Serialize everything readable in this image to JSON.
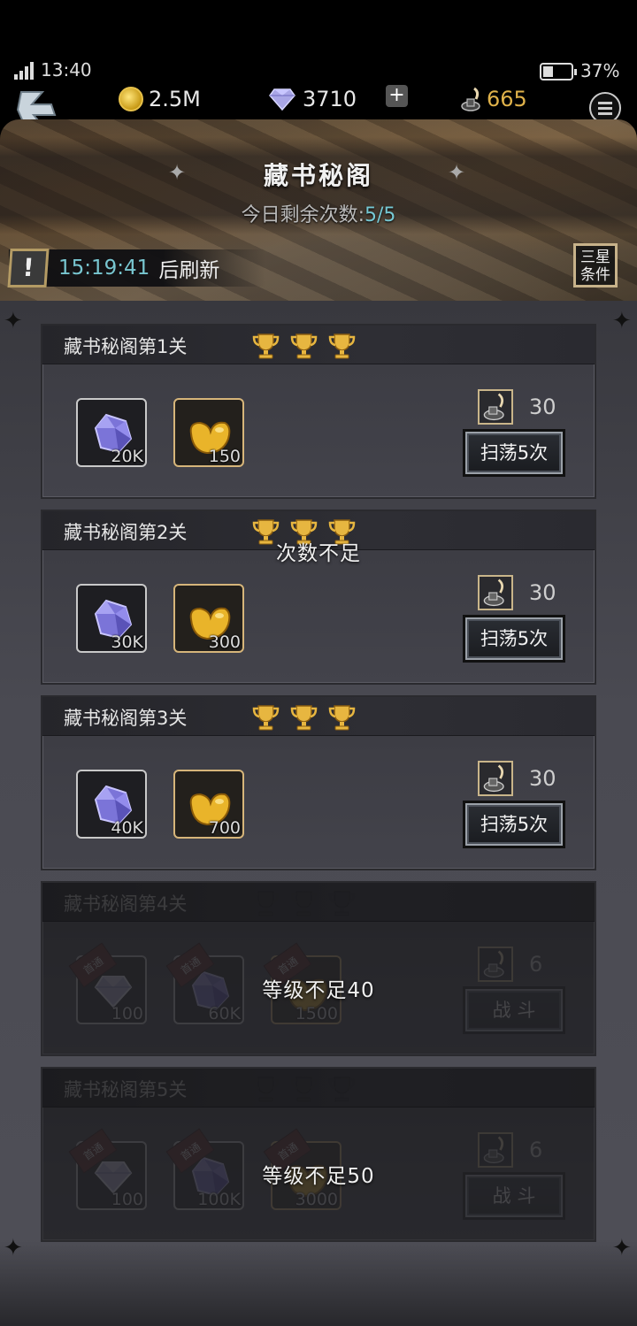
{
  "status": {
    "time": "13:40",
    "battery": "37%",
    "battery_level": 0.37
  },
  "currencies": {
    "coin": "2.5M",
    "diamond": "3710",
    "ink": "665",
    "ink_color": "#e0b24a"
  },
  "header": {
    "title": "藏书秘阁",
    "remaining_label": "今日剩余次数:",
    "remaining_value": "5/5",
    "refresh_time": "15:19:41",
    "refresh_label": "后刷新",
    "condition_button": [
      "三星",
      "条件"
    ]
  },
  "stages": [
    {
      "title": "藏书秘阁第1关",
      "trophies": 3,
      "locked": false,
      "rewards": [
        {
          "icon": "crystal-icon",
          "count": "20K"
        },
        {
          "icon": "gold-bean-icon",
          "count": "150"
        }
      ],
      "cost": "30",
      "action": "扫荡5次",
      "overlay": ""
    },
    {
      "title": "藏书秘阁第2关",
      "trophies": 3,
      "locked": false,
      "rewards": [
        {
          "icon": "crystal-icon",
          "count": "30K"
        },
        {
          "icon": "gold-bean-icon",
          "count": "300"
        }
      ],
      "cost": "30",
      "action": "扫荡5次",
      "overlay": "次数不足"
    },
    {
      "title": "藏书秘阁第3关",
      "trophies": 3,
      "locked": false,
      "rewards": [
        {
          "icon": "crystal-icon",
          "count": "40K"
        },
        {
          "icon": "gold-bean-icon",
          "count": "700"
        }
      ],
      "cost": "30",
      "action": "扫荡5次",
      "overlay": ""
    },
    {
      "title": "藏书秘阁第4关",
      "trophies": 0,
      "locked": true,
      "first_clear_tag": "首通",
      "rewards": [
        {
          "icon": "diamond-icon",
          "count": "100"
        },
        {
          "icon": "crystal-icon",
          "count": "60K"
        },
        {
          "icon": "gold-bean-icon",
          "count": "1500"
        }
      ],
      "cost": "6",
      "action": "战 斗",
      "overlay": "等级不足40"
    },
    {
      "title": "藏书秘阁第5关",
      "trophies": 0,
      "locked": true,
      "first_clear_tag": "首通",
      "rewards": [
        {
          "icon": "diamond-icon",
          "count": "100"
        },
        {
          "icon": "crystal-icon",
          "count": "100K"
        },
        {
          "icon": "gold-bean-icon",
          "count": "3000"
        }
      ],
      "cost": "6",
      "action": "战 斗",
      "overlay": "等级不足50"
    }
  ]
}
